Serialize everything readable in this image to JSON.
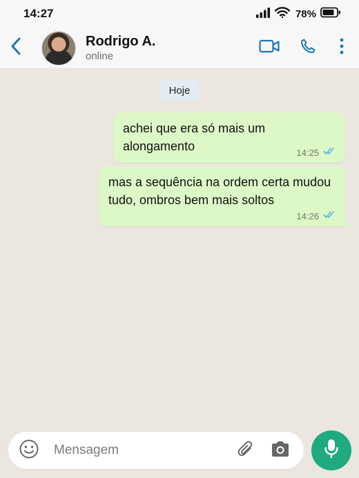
{
  "status_bar": {
    "time": "14:27",
    "battery": "78%"
  },
  "header": {
    "contact_name": "Rodrigo A.",
    "contact_status": "online"
  },
  "chat": {
    "date_chip": "Hoje",
    "messages": [
      {
        "text": "achei que era só mais um alongamento",
        "time": "14:25",
        "status": "read"
      },
      {
        "text": "mas a sequência na ordem certa mudou tudo, ombros bem mais soltos",
        "time": "14:26",
        "status": "read"
      }
    ]
  },
  "composer": {
    "placeholder": "Mensagem"
  },
  "colors": {
    "accent": "#1faa7f",
    "outgoing_bubble": "#dcf8c6",
    "header_icon": "#1877b9",
    "read_tick": "#4fb6ec"
  },
  "icons": [
    "signal-icon",
    "wifi-icon",
    "battery-icon",
    "back-arrow-icon",
    "video-call-icon",
    "phone-icon",
    "more-vert-icon",
    "double-check-icon",
    "emoji-icon",
    "attach-icon",
    "camera-icon",
    "mic-icon"
  ]
}
